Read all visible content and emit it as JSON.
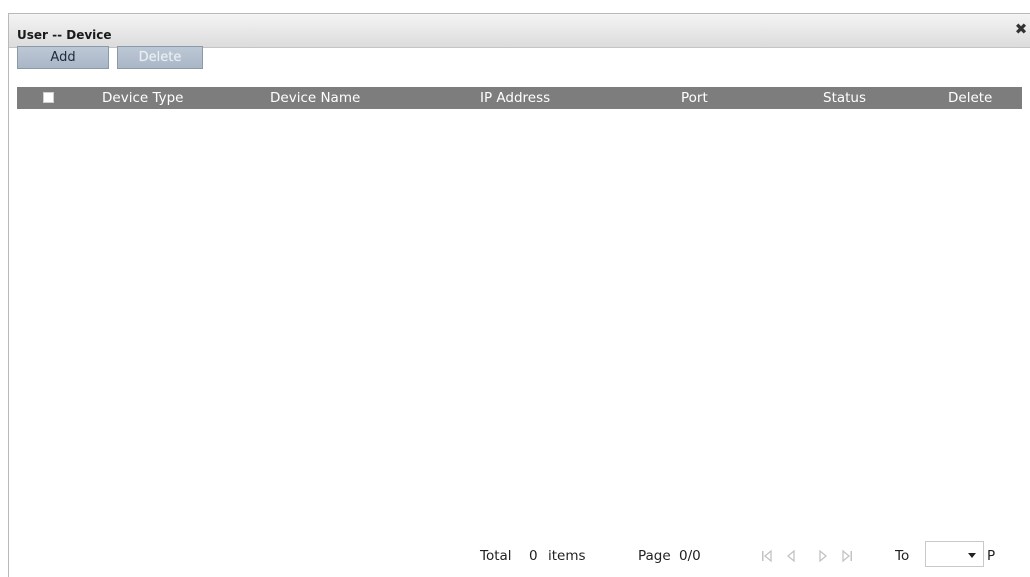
{
  "dialog": {
    "title": "User -- Device",
    "close_icon": "close-icon"
  },
  "toolbar": {
    "add_label": "Add",
    "delete_label": "Delete"
  },
  "grid": {
    "columns": [
      "Device Type",
      "Device Name",
      "IP Address",
      "Port",
      "Status",
      "Delete"
    ],
    "rows": []
  },
  "pager": {
    "total_label": "Total",
    "total_count": "0",
    "items_label": "items",
    "page_label": "Page",
    "page_value": "0/0",
    "to_label": "To",
    "p_label": "P",
    "goto_value": ""
  },
  "colors": {
    "header_bg": "#7d7d7d",
    "button_bg": "#b3bfcd",
    "titlebar_bg": "#e6e6e6"
  }
}
